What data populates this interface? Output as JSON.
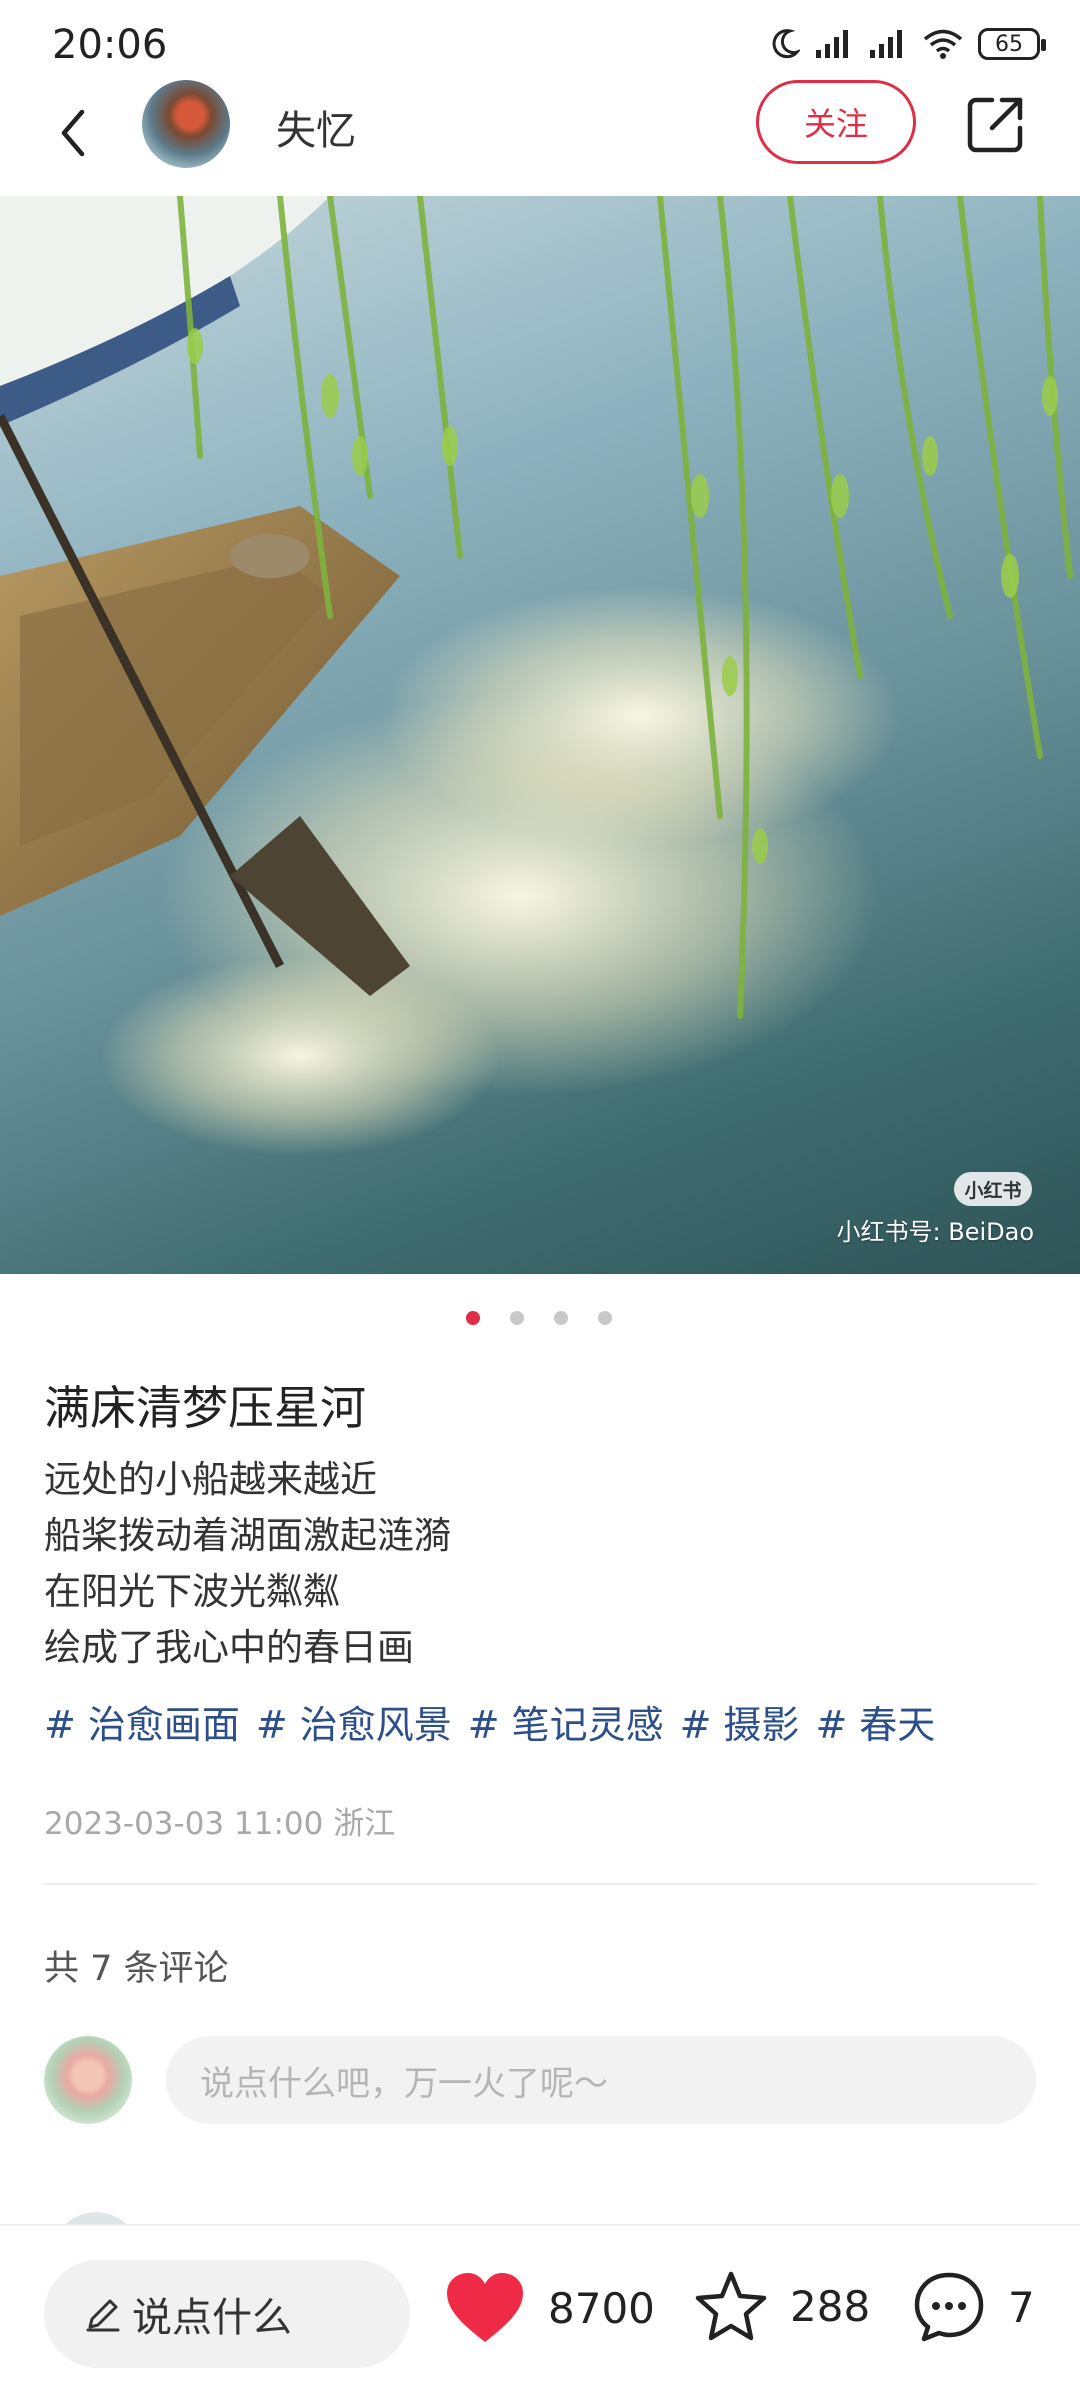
{
  "status_bar": {
    "time": "20:06",
    "battery": "65"
  },
  "header": {
    "username": "失忆",
    "follow_label": "关注"
  },
  "photo": {
    "watermark_badge": "小红书",
    "watermark_text": "小红书号: BeiDao"
  },
  "carousel": {
    "total": 4,
    "active_index": 0
  },
  "post": {
    "title": "满床清梦压星河",
    "lines": [
      "远处的小船越来越近",
      "船桨拨动着湖面激起涟漪",
      "在阳光下波光粼粼",
      "绘成了我心中的春日画"
    ],
    "tags": [
      "治愈画面",
      "治愈风景",
      "笔记灵感",
      "摄影",
      "春天"
    ],
    "meta": "2023-03-03 11:00 浙江"
  },
  "comments": {
    "count_label": "共 7 条评论",
    "input_placeholder": "说点什么吧，万一火了呢～"
  },
  "bottom_bar": {
    "say_label": "说点什么",
    "likes": "8700",
    "collects": "288",
    "comments": "7"
  },
  "colors": {
    "accent": "#e02e46",
    "tag": "#2c4f8a"
  },
  "icons": [
    "back-icon",
    "share-icon",
    "pencil-icon",
    "heart-icon",
    "star-icon",
    "comment-icon"
  ]
}
